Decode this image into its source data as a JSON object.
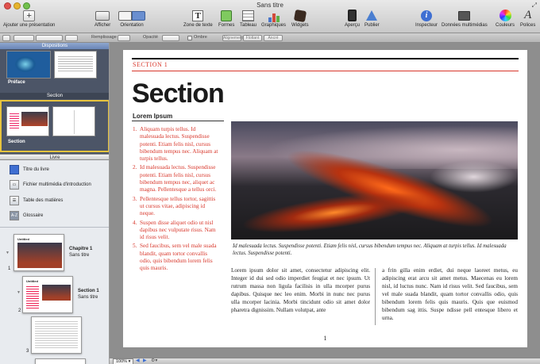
{
  "window": {
    "title": "Sans titre"
  },
  "toolbar": {
    "add_presentation": "Ajouter une présentation",
    "afficher": "Afficher",
    "orientation": "Orientation",
    "zone_de_texte": "Zone de texte",
    "formes": "Formes",
    "tableau": "Tableau",
    "graphiques": "Graphiques",
    "widgets": "Widgets",
    "apercu": "Aperçu",
    "publier": "Publier",
    "inspecteur": "Inspecteur",
    "donnees": "Données multimédias",
    "couleurs": "Couleurs",
    "polices": "Polices"
  },
  "format_bar": {
    "remplissage": "Remplissage",
    "opacite": "Opacité",
    "ombre": "Ombre",
    "aligner": [
      "Alignement",
      "Flottant",
      "Ancré"
    ]
  },
  "sidebar": {
    "dispositions_header": "Dispositions",
    "layouts": [
      {
        "label": "Préface"
      },
      {
        "label": "Section"
      }
    ],
    "section_band": "Section",
    "livre_header": "Livre",
    "book_items": [
      {
        "label": "Titre du livre",
        "icon": "book-icon"
      },
      {
        "label": "Fichier multimédia d'introduction",
        "icon": "media-icon"
      },
      {
        "label": "Table des matières",
        "icon": "list-icon"
      },
      {
        "label": "Glossaire",
        "icon": "az-icon"
      }
    ],
    "pages": [
      {
        "num": "1",
        "title": "Chapitre 1",
        "subtitle": "Sans titre",
        "thumb_text": "Untitled"
      },
      {
        "num": "2",
        "title": "Section 1",
        "subtitle": "Sans titre",
        "thumb_text": "Untitled"
      },
      {
        "num": "3",
        "title": "",
        "subtitle": "",
        "thumb_text": ""
      }
    ]
  },
  "page": {
    "section_label": "SECTION 1",
    "heading": "Section",
    "lorem_heading": "Lorem Ipsum",
    "list": [
      "Aliquam turpis tellus. Id malesuada lectus. Suspendisse potenti. Etiam felis nisl, cursus bibendum tempus nec. Aliquam at turpis tellus.",
      "Id malesuada lectus. Suspendisse potenti. Etiam felis nisl, cursus bibendum tempus nec, aliquet ac magna. Pellentesque a tellus orci.",
      "Pellentesque tellus tortor, sagittis ut cursus vitae, adipiscing id neque.",
      "Suspen disse aliquet odio ut nisl dapibus nec vulputate risus. Nam id risus velit.",
      "Sed faucibus, sem vel male suada blandit, quam tortor convallis odio, quis bibendum lorem felis quis mauris."
    ],
    "caption": "Id malesuada lectus. Suspendisse potenti. Etiam felis nisl, cursus bibendum tempus nec. Aliquam at turpis tellus. Id malesuada lectus. Suspendisse potenti.",
    "col1": "Lorem ipsum dolor sit amet, consectetur adipiscing elit. Integer id dui sed odio imperdiet feugiat et nec ipsum. Ut rutrum massa non ligula facilisis in ulla mcorper purus dapibus. Quisque nec leo enim. Morbi in nunc nec purus ulla mcorper lacinia. Morbi tincidunt odio sit amet dolor pharetra dignissim. Nullam volutpat, ante",
    "col2": "a frin gilla enim erdiet, dui neque laoreet metus, eu adipiscing erat arcu sit amet metus. Maecenas eu lorem nisl, id luctus nunc. Nam id risus velit. Sed faucibus, sem vel male suada blandit, quam tortor convallis odio, quis bibendum lorem felis quis mauris. Quis que euismod bibendum sag ittis. Suspe ndisse pell entesque libero et urna.",
    "page_number": "1"
  },
  "status": {
    "zoom": "100%"
  }
}
